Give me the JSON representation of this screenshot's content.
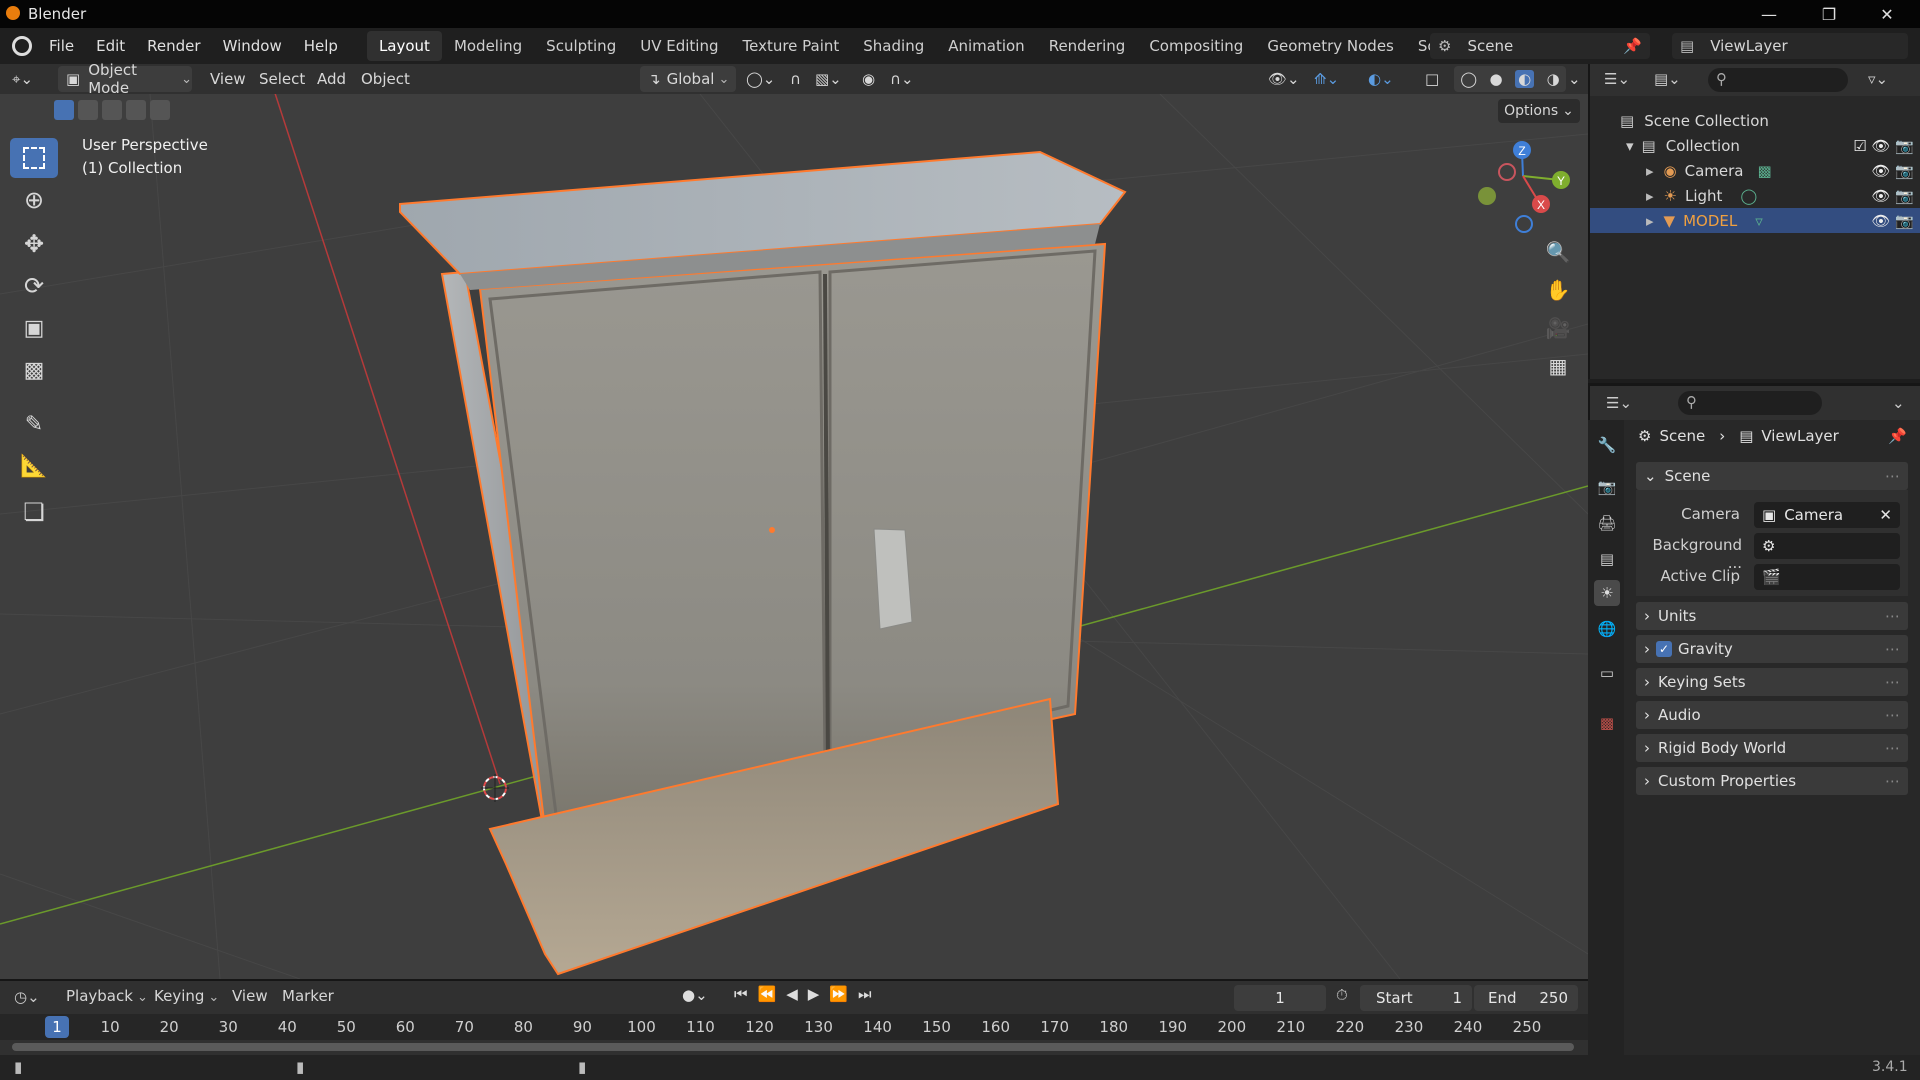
{
  "app": {
    "title": "Blender",
    "version": "3.4.1"
  },
  "menus": [
    "File",
    "Edit",
    "Render",
    "Window",
    "Help"
  ],
  "workspaces": [
    "Layout",
    "Modeling",
    "Sculpting",
    "UV Editing",
    "Texture Paint",
    "Shading",
    "Animation",
    "Rendering",
    "Compositing",
    "Geometry Nodes",
    "Scripting"
  ],
  "active_workspace": "Layout",
  "scene_selector": "Scene",
  "viewlayer_selector": "ViewLayer",
  "viewport_header": {
    "mode": "Object Mode",
    "menus": [
      "View",
      "Select",
      "Add",
      "Object"
    ],
    "orientation": "Global",
    "options_label": "Options"
  },
  "viewport": {
    "perspective": "User Perspective",
    "collection": "(1) Collection",
    "gizmo_axes": {
      "z": "Z",
      "y": "Y",
      "x": "X"
    }
  },
  "outliner": {
    "root": "Scene Collection",
    "collection": "Collection",
    "items": [
      {
        "label": "Camera",
        "icon": "camera-icon",
        "color": "#d8d8d8"
      },
      {
        "label": "Light",
        "icon": "light-icon",
        "color": "#d8d8d8"
      },
      {
        "label": "MODEL",
        "icon": "mesh-icon",
        "color": "#f0a040",
        "selected": true
      }
    ]
  },
  "properties": {
    "breadcrumb": [
      "Scene",
      "ViewLayer"
    ],
    "scene_panel": "Scene",
    "camera_label": "Camera",
    "camera_value": "Camera",
    "background_label": "Background ...",
    "active_clip_label": "Active Clip",
    "collapsed_panels": [
      "Units",
      "Gravity",
      "Keying Sets",
      "Audio",
      "Rigid Body World",
      "Custom Properties"
    ],
    "gravity_checked": true
  },
  "timeline": {
    "menus": [
      "Playback",
      "Keying",
      "View",
      "Marker"
    ],
    "current_frame": "1",
    "start_label": "Start",
    "start_value": "1",
    "end_label": "End",
    "end_value": "250",
    "ticks": [
      "1",
      "10",
      "20",
      "30",
      "40",
      "50",
      "60",
      "70",
      "80",
      "90",
      "100",
      "110",
      "120",
      "130",
      "140",
      "150",
      "160",
      "170",
      "180",
      "190",
      "200",
      "210",
      "220",
      "230",
      "240",
      "250"
    ]
  },
  "colors": {
    "accent": "#4772b3",
    "selection_outline": "#ff7a2e",
    "x_axis": "#d94a4a",
    "y_axis": "#7fae2e",
    "z_axis": "#3f7fd8"
  }
}
